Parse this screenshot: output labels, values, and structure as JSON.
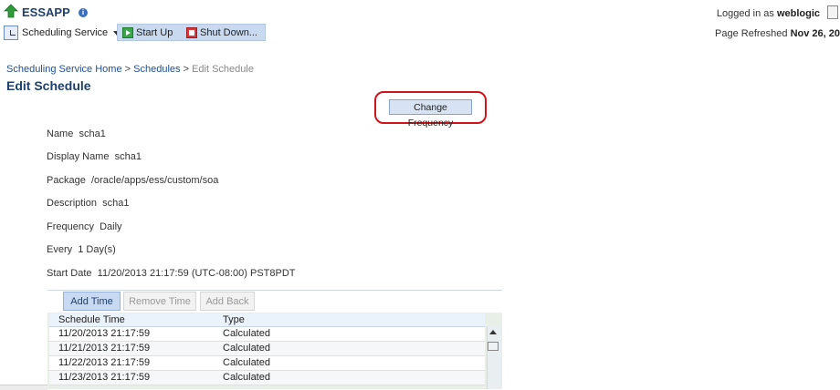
{
  "header": {
    "app_name": "ESSAPP",
    "logged_in_label": "Logged in as",
    "username": "weblogic",
    "page_refreshed_label": "Page Refreshed",
    "page_refreshed_value": "Nov 26, 20"
  },
  "toolbar": {
    "scheduling_service_label": "Scheduling Service",
    "start_up_label": "Start Up",
    "shut_down_label": "Shut Down..."
  },
  "breadcrumb": {
    "home": "Scheduling Service Home",
    "separator": ">",
    "schedules": "Schedules",
    "current": "Edit Schedule"
  },
  "page_title": "Edit Schedule",
  "change_frequency_label": "Change Frequency",
  "fields": [
    {
      "label": "Name",
      "value": "scha1"
    },
    {
      "label": "Display Name",
      "value": "scha1"
    },
    {
      "label": "Package",
      "value": "/oracle/apps/ess/custom/soa"
    },
    {
      "label": "Description",
      "value": "scha1"
    },
    {
      "label": "Frequency",
      "value": "Daily"
    },
    {
      "label": "Every",
      "value": "1 Day(s)"
    },
    {
      "label": "Start Date",
      "value": "11/20/2013 21:17:59 (UTC-08:00) PST8PDT"
    }
  ],
  "tabs": {
    "add_time": "Add Time",
    "remove_time": "Remove Time",
    "add_back": "Add Back"
  },
  "table": {
    "columns": [
      "Schedule Time",
      "Type"
    ],
    "rows": [
      [
        "11/20/2013 21:17:59",
        "Calculated"
      ],
      [
        "11/21/2013 21:17:59",
        "Calculated"
      ],
      [
        "11/22/2013 21:17:59",
        "Calculated"
      ],
      [
        "11/23/2013 21:17:59",
        "Calculated"
      ]
    ]
  },
  "colors": {
    "title_blue": "#1f3f6e",
    "link_blue": "#1f4f8f",
    "highlight_red": "#d0141a"
  }
}
